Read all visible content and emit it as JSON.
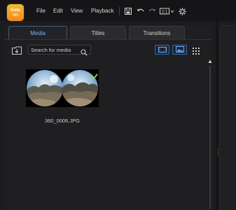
{
  "app": {
    "logo_line1": "Insta",
    "logo_line2": "360",
    "logo_color": "#f39a25"
  },
  "menu": {
    "file": "File",
    "edit": "Edit",
    "view": "View",
    "playback": "Playback"
  },
  "toolbar_icons": [
    "save-icon",
    "undo-icon",
    "redo-icon",
    "aspect-ratio-dropdown-icon",
    "settings-gear-icon"
  ],
  "tabs": [
    {
      "label": "Media",
      "active": true
    },
    {
      "label": "Titles",
      "active": false
    },
    {
      "label": "Transitions",
      "active": false
    }
  ],
  "media_toolbar": {
    "search_placeholder": "Search for media",
    "icons": [
      "import-media-icon",
      "search-icon",
      "timeline-view-icon",
      "image-view-icon",
      "grid-menu-icon"
    ]
  },
  "media_items": [
    {
      "filename": "360_0006.JPG",
      "selected": true
    }
  ],
  "colors": {
    "accent": "#6fb4ff",
    "background": "#1c1c1e",
    "check": "#7ed957"
  }
}
